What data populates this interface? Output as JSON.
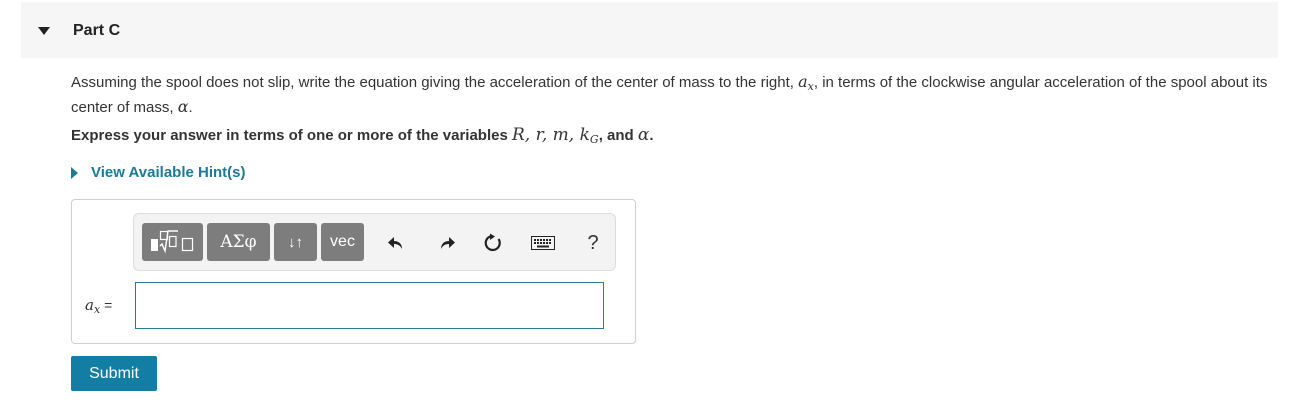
{
  "part": {
    "title": "Part C"
  },
  "question": {
    "text_before_ax": "Assuming the spool does not slip, write the equation giving the acceleration of the center of mass to the right, ",
    "ax_symbol": "a",
    "ax_sub": "x",
    "text_after_ax": ", in terms of the clockwise angular acceleration of the spool about its center of mass, ",
    "alpha": "α",
    "end": "."
  },
  "instruction": {
    "prefix": "Express your answer in terms of one or more of the variables ",
    "vars": "R, r, m, k",
    "var_sub": "G",
    "middle": ", and ",
    "last_var": "α",
    "end": "."
  },
  "hint": {
    "label": "View Available Hint(s)"
  },
  "toolbar": {
    "greek_label": "ΑΣφ",
    "sort_label": "↓↑",
    "vec_label": "vec",
    "help_label": "?",
    "icons": [
      "templates-icon",
      "undo-icon",
      "redo-icon",
      "reset-icon",
      "keyboard-icon",
      "help-icon"
    ]
  },
  "answer": {
    "var_symbol": "a",
    "var_sub": "x",
    "equals": "=",
    "value": ""
  },
  "submit": {
    "label": "Submit"
  },
  "colors": {
    "accent": "#127ea3",
    "link": "#1a7a9a",
    "toolbar_button": "#7d7d7d"
  }
}
